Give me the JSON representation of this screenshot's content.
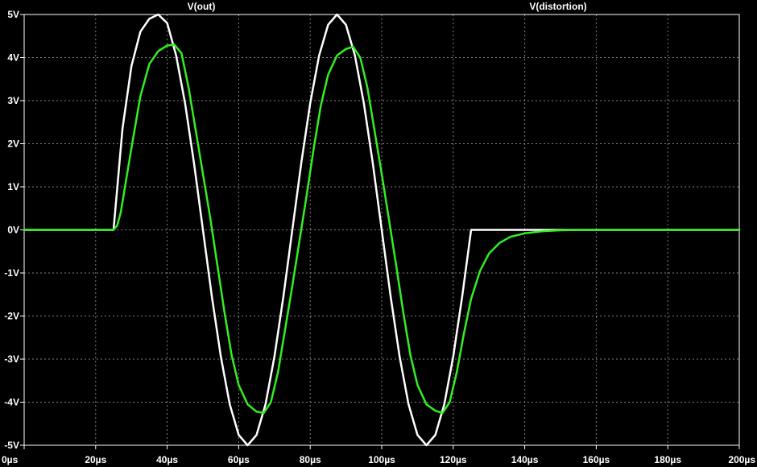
{
  "chart_data": {
    "type": "line",
    "xlim": [
      0,
      200
    ],
    "ylim": [
      -5,
      5
    ],
    "grid": true,
    "legend": "top",
    "background_color": "#000000",
    "axis_color": "#ffffff",
    "grid_color": "#808080",
    "x_ticks": [
      {
        "value": 0,
        "label": "0µs"
      },
      {
        "value": 20,
        "label": "20µs"
      },
      {
        "value": 40,
        "label": "40µs"
      },
      {
        "value": 60,
        "label": "60µs"
      },
      {
        "value": 80,
        "label": "80µs"
      },
      {
        "value": 100,
        "label": "100µs"
      },
      {
        "value": 120,
        "label": "120µs"
      },
      {
        "value": 140,
        "label": "140µs"
      },
      {
        "value": 160,
        "label": "160µs"
      },
      {
        "value": 180,
        "label": "180µs"
      },
      {
        "value": 200,
        "label": "200µs"
      }
    ],
    "y_ticks": [
      {
        "value": 5,
        "label": "5V"
      },
      {
        "value": 4,
        "label": "4V"
      },
      {
        "value": 3,
        "label": "3V"
      },
      {
        "value": 2,
        "label": "2V"
      },
      {
        "value": 1,
        "label": "1V"
      },
      {
        "value": 0,
        "label": "0V"
      },
      {
        "value": -1,
        "label": "-1V"
      },
      {
        "value": -2,
        "label": "-2V"
      },
      {
        "value": -3,
        "label": "-3V"
      },
      {
        "value": -4,
        "label": "-4V"
      },
      {
        "value": -5,
        "label": "-5V"
      }
    ],
    "series": [
      {
        "name": "V(out)",
        "color": "#ffffff",
        "points": [
          [
            0,
            0
          ],
          [
            25,
            0
          ],
          [
            27.5,
            2.35
          ],
          [
            30,
            3.8
          ],
          [
            32.5,
            4.6
          ],
          [
            35,
            4.9
          ],
          [
            37.5,
            5.0
          ],
          [
            40,
            4.8
          ],
          [
            42.5,
            4.05
          ],
          [
            45,
            2.94
          ],
          [
            47.5,
            1.55
          ],
          [
            50,
            0
          ],
          [
            52.5,
            -1.55
          ],
          [
            55,
            -2.94
          ],
          [
            57.5,
            -4.05
          ],
          [
            60,
            -4.76
          ],
          [
            62.5,
            -5.0
          ],
          [
            65,
            -4.76
          ],
          [
            67.5,
            -4.05
          ],
          [
            70,
            -2.94
          ],
          [
            72.5,
            -1.55
          ],
          [
            75,
            0
          ],
          [
            77.5,
            1.55
          ],
          [
            80,
            2.94
          ],
          [
            82.5,
            4.05
          ],
          [
            85,
            4.76
          ],
          [
            87.5,
            5.0
          ],
          [
            90,
            4.76
          ],
          [
            92.5,
            4.05
          ],
          [
            95,
            2.94
          ],
          [
            97.5,
            1.55
          ],
          [
            100,
            0
          ],
          [
            102.5,
            -1.55
          ],
          [
            105,
            -2.94
          ],
          [
            107.5,
            -4.05
          ],
          [
            110,
            -4.76
          ],
          [
            112.5,
            -5.0
          ],
          [
            115,
            -4.76
          ],
          [
            117.5,
            -4.05
          ],
          [
            120,
            -2.94
          ],
          [
            122.5,
            -1.55
          ],
          [
            125,
            0
          ],
          [
            200,
            0
          ]
        ]
      },
      {
        "name": "V(distortion)",
        "color": "#33ee22",
        "points": [
          [
            0,
            0
          ],
          [
            25,
            0
          ],
          [
            26,
            0.1
          ],
          [
            27,
            0.4
          ],
          [
            28,
            0.9
          ],
          [
            30,
            1.9
          ],
          [
            32.5,
            3.1
          ],
          [
            35,
            3.85
          ],
          [
            37.5,
            4.15
          ],
          [
            40,
            4.28
          ],
          [
            42,
            4.3
          ],
          [
            44,
            4.1
          ],
          [
            46,
            3.3
          ],
          [
            48,
            2.3
          ],
          [
            50,
            1.3
          ],
          [
            52,
            0.3
          ],
          [
            54,
            -0.8
          ],
          [
            56,
            -1.9
          ],
          [
            58,
            -2.9
          ],
          [
            60,
            -3.6
          ],
          [
            62.5,
            -4.05
          ],
          [
            65,
            -4.22
          ],
          [
            67,
            -4.25
          ],
          [
            69,
            -4.0
          ],
          [
            71,
            -3.3
          ],
          [
            73,
            -2.3
          ],
          [
            75,
            -1.3
          ],
          [
            77,
            -0.25
          ],
          [
            79,
            0.8
          ],
          [
            81,
            1.9
          ],
          [
            83,
            2.9
          ],
          [
            85,
            3.6
          ],
          [
            87.5,
            4.05
          ],
          [
            90,
            4.2
          ],
          [
            92,
            4.25
          ],
          [
            94,
            4.0
          ],
          [
            96,
            3.3
          ],
          [
            98,
            2.3
          ],
          [
            100,
            1.3
          ],
          [
            102,
            0.25
          ],
          [
            104,
            -0.8
          ],
          [
            106,
            -1.9
          ],
          [
            108,
            -2.9
          ],
          [
            110,
            -3.6
          ],
          [
            112.5,
            -4.05
          ],
          [
            115,
            -4.2
          ],
          [
            117,
            -4.25
          ],
          [
            119,
            -4.0
          ],
          [
            121,
            -3.3
          ],
          [
            123,
            -2.4
          ],
          [
            125,
            -1.6
          ],
          [
            127.5,
            -0.95
          ],
          [
            130,
            -0.55
          ],
          [
            133,
            -0.3
          ],
          [
            136,
            -0.16
          ],
          [
            140,
            -0.08
          ],
          [
            145,
            -0.03
          ],
          [
            150,
            -0.01
          ],
          [
            155,
            0
          ],
          [
            200,
            0
          ]
        ]
      }
    ]
  }
}
